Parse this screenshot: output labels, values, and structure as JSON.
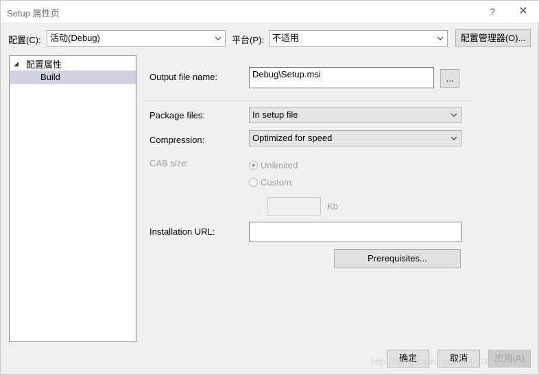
{
  "window": {
    "title": "Setup 属性页",
    "help_label": "?",
    "close_label": "✕"
  },
  "toolbar": {
    "config_label": "配置(C):",
    "config_value": "活动(Debug)",
    "platform_label": "平台(P):",
    "platform_value": "不适用",
    "config_manager_label": "配置管理器(O)..."
  },
  "tree": {
    "root_label": "配置属性",
    "items": [
      {
        "label": "Build"
      }
    ]
  },
  "build": {
    "output_file_label": "Output file name:",
    "output_file_value": "Debug\\Setup.msi",
    "browse_label": "...",
    "package_files_label": "Package files:",
    "package_files_value": "In setup file",
    "compression_label": "Compression:",
    "compression_value": "Optimized for speed",
    "cab_size_label": "CAB size:",
    "unlimited_label": "Unlimited",
    "custom_label": "Custom:",
    "kb_label": "Kb",
    "installation_url_label": "Installation URL:",
    "installation_url_value": "",
    "prerequisites_label": "Prerequisites..."
  },
  "footer": {
    "ok_label": "确定",
    "cancel_label": "取消",
    "apply_label": "应用(A)"
  },
  "watermark": "https://blog.csdn.net/u014453443"
}
